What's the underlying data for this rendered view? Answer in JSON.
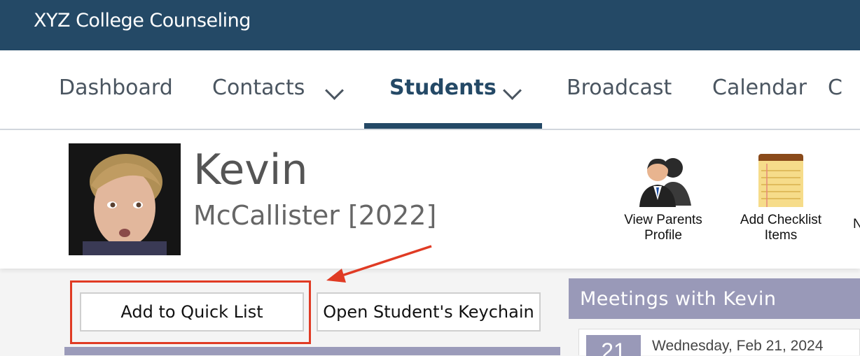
{
  "app": {
    "title": "XYZ College Counseling"
  },
  "nav": {
    "items": [
      {
        "label": "Dashboard"
      },
      {
        "label": "Contacts"
      },
      {
        "label": "Students"
      },
      {
        "label": "Broadcast"
      },
      {
        "label": "Calendar"
      },
      {
        "label": "C"
      }
    ],
    "active": "Students"
  },
  "student": {
    "first_name": "Kevin",
    "last_name_year": "McCallister [2022]"
  },
  "actions": {
    "view_parents": "View Parents Profile",
    "add_checklist": "Add Checklist Items",
    "partial_next": "N"
  },
  "buttons": {
    "add_quick_list": "Add to Quick List",
    "open_keychain": "Open Student's Keychain"
  },
  "meetings": {
    "header": "Meetings with Kevin",
    "items": [
      {
        "day": "21",
        "date": "Wednesday, Feb 21, 2024"
      }
    ]
  },
  "colors": {
    "topbar": "#244966",
    "accent_lavender": "#9999b8",
    "annotation_red": "#e03b24"
  }
}
